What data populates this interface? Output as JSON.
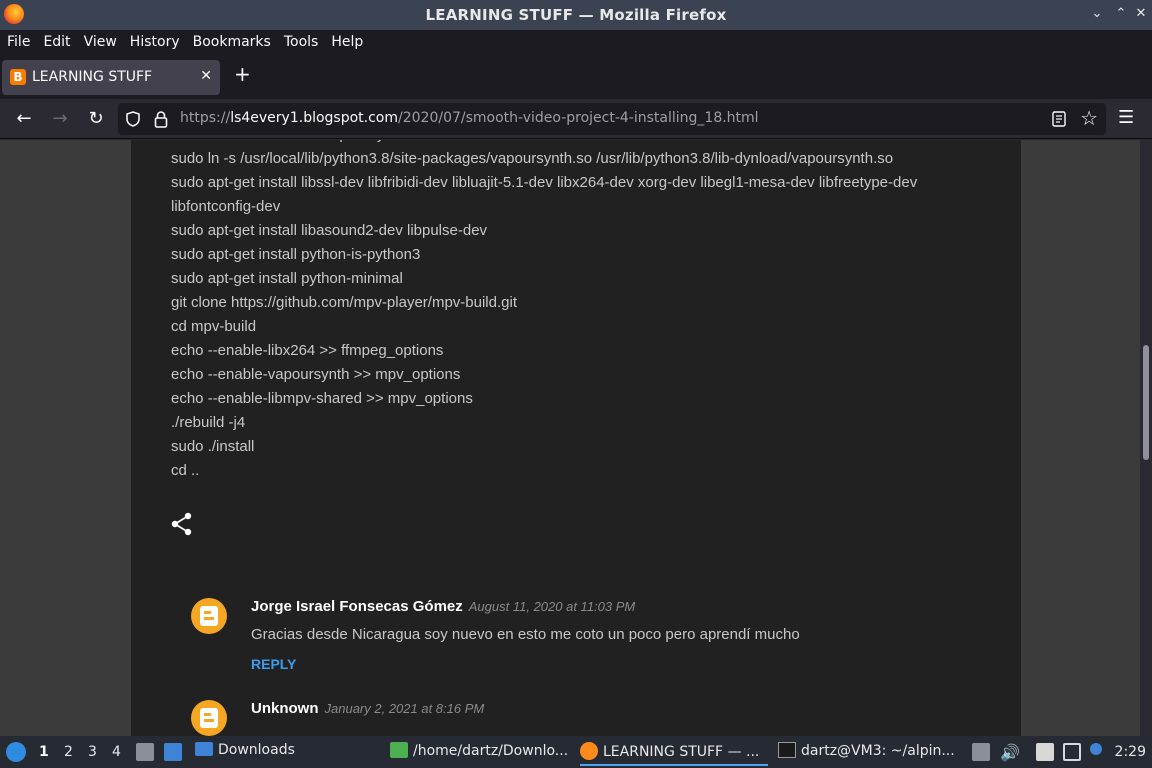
{
  "window": {
    "title": "LEARNING STUFF — Mozilla Firefox"
  },
  "menu": [
    "File",
    "Edit",
    "View",
    "History",
    "Bookmarks",
    "Tools",
    "Help"
  ],
  "tab": {
    "title": "LEARNING STUFF",
    "favicon": "B"
  },
  "url": {
    "scheme": "https://",
    "host": "ls4every1.blogspot.com",
    "path": "/2020/07/smooth-video-project-4-installing_18.html"
  },
  "post": {
    "lines": [
      "sudo ln -s /usr/local/lib/python3.8/site-packages/vapoursynth.so /usr/lib/python3.8/lib-dynload/vapoursynth.so",
      "sudo apt-get install libssl-dev libfribidi-dev libluajit-5.1-dev libx264-dev xorg-dev libegl1-mesa-dev libfreetype-dev",
      "libfontconfig-dev",
      "sudo apt-get install libasound2-dev libpulse-dev",
      "sudo apt-get install python-is-python3",
      "sudo apt-get install python-minimal",
      "git clone https://github.com/mpv-player/mpv-build.git",
      "cd mpv-build",
      "echo --enable-libx264 >> ffmpeg_options",
      "echo --enable-vapoursynth >> mpv_options",
      "echo --enable-libmpv-shared >> mpv_options",
      "./rebuild -j4",
      "sudo ./install",
      "cd .."
    ]
  },
  "comments": [
    {
      "author": "Jorge Israel Fonsecas Gómez",
      "date": "August 11, 2020 at 11:03 PM",
      "text": "Gracias desde Nicaragua soy nuevo en esto me coto un poco pero aprendí mucho",
      "reply": "REPLY"
    },
    {
      "author": "Unknown",
      "date": "January 2, 2021 at 8:16 PM"
    }
  ],
  "taskbar": {
    "workspaces": [
      "1",
      "2",
      "3",
      "4"
    ],
    "tasks": [
      "Downloads",
      "/home/dartz/Downlo...",
      "LEARNING STUFF — ...",
      "dartz@VM3: ~/alpin..."
    ],
    "clock": "2:29"
  }
}
